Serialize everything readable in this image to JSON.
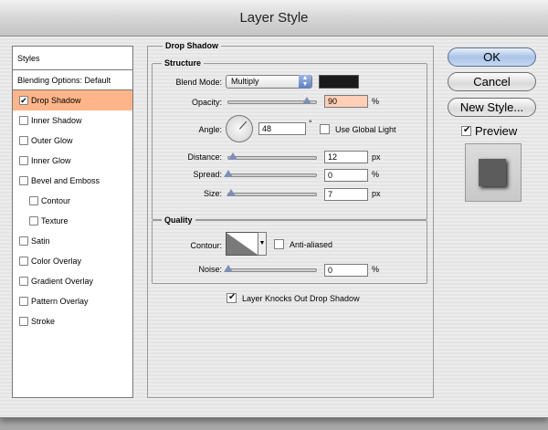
{
  "window": {
    "title": "Layer Style"
  },
  "styles": {
    "header": "Styles",
    "blending": "Blending Options: Default",
    "items": [
      {
        "label": "Drop Shadow",
        "checked": true,
        "selected": true,
        "sub": false
      },
      {
        "label": "Inner Shadow",
        "checked": false,
        "selected": false,
        "sub": false
      },
      {
        "label": "Outer Glow",
        "checked": false,
        "selected": false,
        "sub": false
      },
      {
        "label": "Inner Glow",
        "checked": false,
        "selected": false,
        "sub": false
      },
      {
        "label": "Bevel and Emboss",
        "checked": false,
        "selected": false,
        "sub": false
      },
      {
        "label": "Contour",
        "checked": false,
        "selected": false,
        "sub": true
      },
      {
        "label": "Texture",
        "checked": false,
        "selected": false,
        "sub": true
      },
      {
        "label": "Satin",
        "checked": false,
        "selected": false,
        "sub": false
      },
      {
        "label": "Color Overlay",
        "checked": false,
        "selected": false,
        "sub": false
      },
      {
        "label": "Gradient Overlay",
        "checked": false,
        "selected": false,
        "sub": false
      },
      {
        "label": "Pattern Overlay",
        "checked": false,
        "selected": false,
        "sub": false
      },
      {
        "label": "Stroke",
        "checked": false,
        "selected": false,
        "sub": false
      }
    ]
  },
  "drop_shadow": {
    "title": "Drop Shadow",
    "structure": {
      "title": "Structure",
      "blend_mode_label": "Blend Mode:",
      "blend_mode_value": "Multiply",
      "shadow_color": "#1a1a1a",
      "opacity_label": "Opacity:",
      "opacity_value": "90",
      "opacity_unit": "%",
      "opacity_fraction": 0.9,
      "angle_label": "Angle:",
      "angle_value": "48",
      "angle_unit": "°",
      "global_light_label": "Use Global Light",
      "global_light_checked": false,
      "distance_label": "Distance:",
      "distance_value": "12",
      "distance_unit": "px",
      "distance_fraction": 0.05,
      "spread_label": "Spread:",
      "spread_value": "0",
      "spread_unit": "%",
      "spread_fraction": 0.0,
      "size_label": "Size:",
      "size_value": "7",
      "size_unit": "px",
      "size_fraction": 0.03
    },
    "quality": {
      "title": "Quality",
      "contour_label": "Contour:",
      "anti_aliased_label": "Anti-aliased",
      "anti_aliased_checked": false,
      "noise_label": "Noise:",
      "noise_value": "0",
      "noise_unit": "%",
      "noise_fraction": 0.0
    },
    "knockout_label": "Layer Knocks Out Drop Shadow",
    "knockout_checked": true
  },
  "buttons": {
    "ok": "OK",
    "cancel": "Cancel",
    "new_style": "New Style...",
    "preview_label": "Preview",
    "preview_checked": true
  },
  "colors": {
    "selected_row": "#ffb58a",
    "highlight_field": "#ffcfb7",
    "accent": "#7d8fb3"
  }
}
